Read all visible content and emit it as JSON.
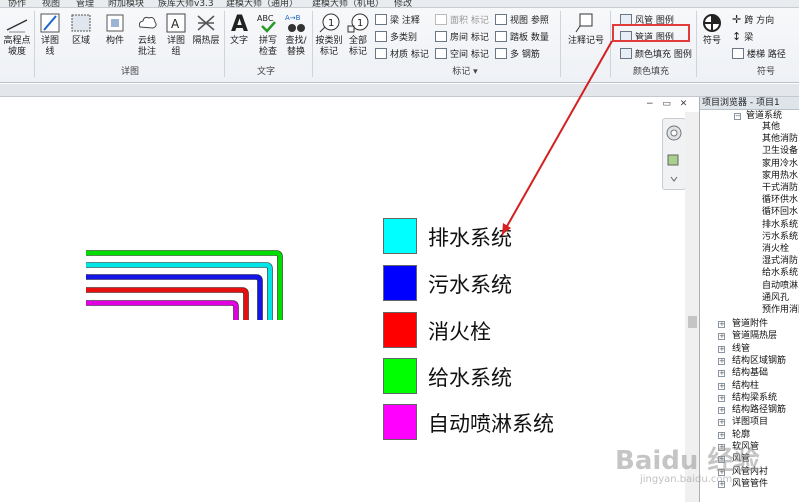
{
  "menu": [
    "协作",
    "视图",
    "管理",
    "附加模块",
    "族库大师v3.3",
    "建模大师（通用）",
    "建模大师（机电）",
    "修改"
  ],
  "ribbon": {
    "slope_label": "高程点\n坡度",
    "detail_line": "详图\n线",
    "region": "区域",
    "component": "构件",
    "revision_cloud": "云线\n批注",
    "detail_group": "详图\n组",
    "insulation": "隔热层",
    "group_detail_label": "详图",
    "text": "文字",
    "spelling": "拼写\n检查",
    "find_replace": "查找/\n替换",
    "group_text_label": "文字",
    "tag_by_category": "按类别\n标记",
    "tag_all": "全部\n标记",
    "beam_annotation": "梁 注释",
    "multi_category": "多类别",
    "material_tag": "材质 标记",
    "area_tag": "面积 标记",
    "room_tag": "房间 标记",
    "space_tag": "空间 标记",
    "view_reference": "视图 参照",
    "tread_number": "踏板 数量",
    "multi_rebar": "多 钢筋",
    "group_tag_label": "标记 ▾",
    "note_block": "注释记号",
    "duct_legend": "风管 图例",
    "pipe_legend": "管道 图例",
    "color_fill_legend": "颜色填充 图例",
    "group_color_fill_label": "颜色填充",
    "symbol": "符号",
    "span_direction": "跨 方向",
    "beam": "梁",
    "stair_path": "楼梯 路径",
    "group_symbol_label": "符号"
  },
  "view_controls": "− ▭ ✕",
  "legend": [
    {
      "label": "排水系统",
      "color": "#00ffff"
    },
    {
      "label": "污水系统",
      "color": "#0000ff"
    },
    {
      "label": "消火栓",
      "color": "#ff0000"
    },
    {
      "label": "给水系统",
      "color": "#00ff00"
    },
    {
      "label": "自动喷淋系统",
      "color": "#ff00ff"
    }
  ],
  "project_browser": {
    "title": "项目浏览器 - 项目1",
    "expanded_header": "管道系统",
    "children": [
      "其他",
      "其他消防系统",
      "卫生设备",
      "家用冷水",
      "家用热水",
      "干式消防系统",
      "循环供水",
      "循环回水",
      "排水系统",
      "污水系统",
      "消火栓",
      "湿式消防系统",
      "给水系统",
      "自动喷淋系统",
      "通风孔",
      "预作用消防系统"
    ],
    "collapsed": [
      "管道附件",
      "管道隔热层",
      "线管",
      "结构区域钢筋",
      "结构基础",
      "结构柱",
      "结构梁系统",
      "结构路径钢筋",
      "详图项目",
      "轮廓",
      "软风管",
      "风管",
      "风管内衬",
      "风管管件"
    ]
  },
  "watermark": "Baidu 经验",
  "watermark_sub": "jingyan.baidu.com"
}
